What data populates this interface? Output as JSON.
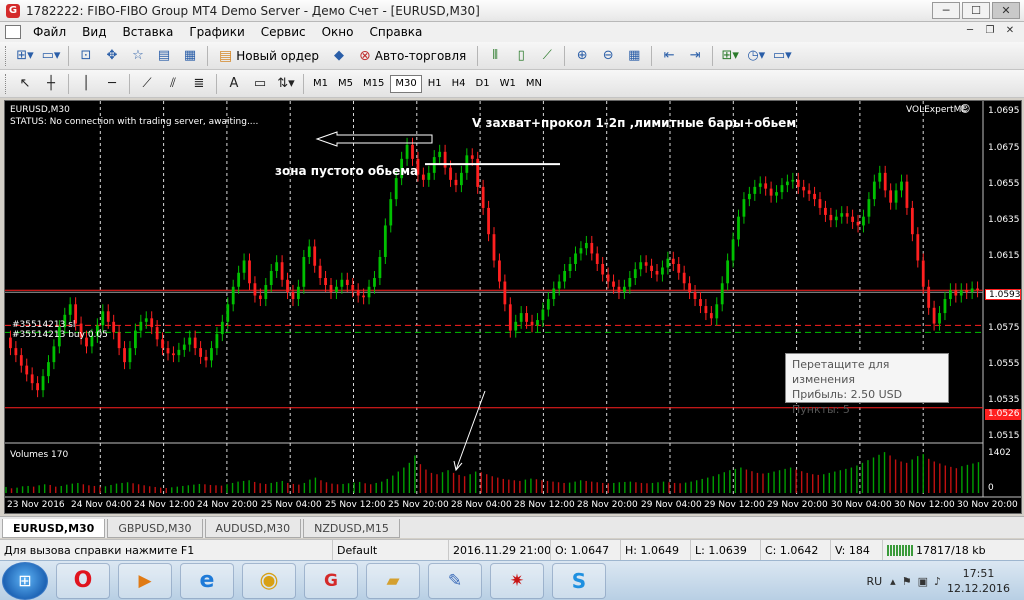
{
  "window": {
    "app_icon": "mt4-logo-icon",
    "title": "1782222: FIBO-FIBO Group MT4 Demo Server - Демо Счет - [EURUSD,M30]"
  },
  "menu": {
    "items": [
      "Файл",
      "Вид",
      "Вставка",
      "Графики",
      "Сервис",
      "Окно",
      "Справка"
    ]
  },
  "toolbar": {
    "new_order": "Новый ордер",
    "autotrade": "Авто-торговля",
    "timeframes": [
      "M1",
      "M5",
      "M15",
      "M30",
      "H1",
      "H4",
      "D1",
      "W1",
      "MN"
    ],
    "active_timeframe": "M30"
  },
  "chart": {
    "symbol": "EURUSD,M30",
    "status": "STATUS:    No connection with trading server, awaiting....",
    "expert": "VOLExpertME",
    "annotation_title": "V захват+прокол 1-2п ,лимитные бары+обьем",
    "annotation_zone": "зона пустого обьема",
    "sl_label": "#35514213 sl",
    "buy_label": "#35514213 buy 0.05",
    "volumes_label": "Volumes 170",
    "colors": {
      "bull": "#00c000",
      "bear": "#ff2020",
      "grid": "#ffffff",
      "price_line": "#ff2020"
    },
    "price_axis": [
      "1.0695",
      "1.0675",
      "1.0655",
      "1.0635",
      "1.0615",
      "1.0575",
      "1.0555",
      "1.0535",
      "1.0515"
    ],
    "current_price": "1.0593",
    "line_price": "1.0526",
    "volume_axis": [
      "1402",
      "0"
    ],
    "date_axis": [
      "23 Nov 2016",
      "24 Nov 04:00",
      "24 Nov 12:00",
      "24 Nov 20:00",
      "25 Nov 04:00",
      "25 Nov 12:00",
      "25 Nov 20:00",
      "28 Nov 04:00",
      "28 Nov 12:00",
      "28 Nov 20:00",
      "29 Nov 04:00",
      "29 Nov 12:00",
      "29 Nov 20:00",
      "30 Nov 04:00",
      "30 Nov 12:00",
      "30 Nov 20:00"
    ],
    "tooltip": {
      "line1": "Перетащите для изменения",
      "line2": "Прибыль: 2.50 USD",
      "line3": "Пункты: 5"
    }
  },
  "chart_data": {
    "type": "bar",
    "title": "EURUSD,M30",
    "ylim": [
      1.0507,
      1.0701
    ],
    "price_series": [
      1.0566,
      1.056,
      1.0556,
      1.055,
      1.0545,
      1.054,
      1.0536,
      1.0544,
      1.0552,
      1.0561,
      1.0572,
      1.0579,
      1.0585,
      1.0574,
      1.0566,
      1.0561,
      1.0567,
      1.0573,
      1.0581,
      1.0575,
      1.0569,
      1.056,
      1.0552,
      1.056,
      1.057,
      1.0575,
      1.0577,
      1.0572,
      1.0565,
      1.056,
      1.0557,
      1.0556,
      1.0559,
      1.0562,
      1.0566,
      1.056,
      1.0555,
      1.0553,
      1.056,
      1.0568,
      1.0575,
      1.0585,
      1.0595,
      1.0603,
      1.061,
      1.0597,
      1.059,
      1.0588,
      1.0596,
      1.0604,
      1.0609,
      1.0599,
      1.0592,
      1.0588,
      1.0595,
      1.0612,
      1.0618,
      1.0607,
      1.06,
      1.0596,
      1.0592,
      1.0595,
      1.0599,
      1.0596,
      1.0593,
      1.059,
      1.0589,
      1.0595,
      1.06,
      1.0612,
      1.063,
      1.0645,
      1.0657,
      1.0668,
      1.0676,
      1.0668,
      1.0659,
      1.0656,
      1.066,
      1.0669,
      1.0672,
      1.0663,
      1.0656,
      1.0653,
      1.066,
      1.067,
      1.0668,
      1.0652,
      1.064,
      1.0625,
      1.061,
      1.0598,
      1.0585,
      1.057,
      1.0575,
      1.058,
      1.0575,
      1.0573,
      1.0576,
      1.0582,
      1.0588,
      1.0594,
      1.0598,
      1.0604,
      1.0608,
      1.0614,
      1.0617,
      1.062,
      1.0614,
      1.0608,
      1.0602,
      1.0598,
      1.0595,
      1.0592,
      1.0595,
      1.06,
      1.0605,
      1.0609,
      1.0607,
      1.0604,
      1.0602,
      1.0606,
      1.0611,
      1.0608,
      1.0603,
      1.0597,
      1.0592,
      1.0588,
      1.0584,
      1.058,
      1.0577,
      1.0585,
      1.0597,
      1.061,
      1.0622,
      1.0635,
      1.0645,
      1.0648,
      1.0652,
      1.0654,
      1.0651,
      1.0647,
      1.0649,
      1.0653,
      1.0655,
      1.0656,
      1.0652,
      1.065,
      1.0648,
      1.0645,
      1.064,
      1.0636,
      1.0633,
      1.0635,
      1.0637,
      1.0635,
      1.0632,
      1.063,
      1.0635,
      1.0645,
      1.0655,
      1.066,
      1.065,
      1.0643,
      1.065,
      1.0655,
      1.064,
      1.0625,
      1.061,
      1.0595,
      1.0583,
      1.0574,
      1.058,
      1.0588,
      1.0593,
      1.059,
      1.0593,
      1.0592,
      1.0594,
      1.0593
    ],
    "volume_series": [
      180,
      140,
      160,
      200,
      210,
      190,
      230,
      260,
      240,
      190,
      210,
      250,
      280,
      300,
      260,
      230,
      210,
      190,
      200,
      240,
      280,
      300,
      320,
      290,
      260,
      230,
      200,
      180,
      160,
      150,
      170,
      190,
      210,
      230,
      250,
      270,
      260,
      240,
      230,
      220,
      260,
      300,
      340,
      360,
      380,
      330,
      290,
      270,
      300,
      330,
      360,
      300,
      270,
      250,
      300,
      400,
      460,
      380,
      320,
      280,
      260,
      270,
      290,
      310,
      330,
      290,
      260,
      300,
      340,
      420,
      520,
      640,
      760,
      900,
      1120,
      860,
      700,
      600,
      560,
      620,
      680,
      600,
      540,
      500,
      560,
      640,
      620,
      560,
      500,
      460,
      420,
      400,
      380,
      360,
      400,
      430,
      410,
      380,
      360,
      340,
      320,
      300,
      310,
      340,
      380,
      360,
      340,
      320,
      300,
      290,
      300,
      320,
      330,
      340,
      320,
      300,
      290,
      300,
      320,
      340,
      320,
      300,
      290,
      310,
      340,
      380,
      420,
      460,
      500,
      560,
      620,
      680,
      720,
      760,
      700,
      650,
      600,
      580,
      600,
      640,
      680,
      720,
      760,
      700,
      650,
      600,
      560,
      540,
      560,
      600,
      640,
      680,
      720,
      760,
      820,
      900,
      980,
      1060,
      1140,
      1220,
      1120,
      1000,
      940,
      900,
      1000,
      1100,
      1160,
      1020,
      940,
      880,
      820,
      780,
      740,
      800,
      840,
      880,
      920
    ],
    "lines": {
      "current_price": 1.0593,
      "sl": 1.0573,
      "buy": 1.0569,
      "red_line": 1.0526,
      "annotation_level": 1.0665
    }
  },
  "tabs": [
    "EURUSD,M30",
    "GBPUSD,M30",
    "AUDUSD,M30",
    "NZDUSD,M15"
  ],
  "status": {
    "help": "Для вызова справки нажмите F1",
    "profile": "Default",
    "datetime": "2016.11.29 21:00",
    "open": "O: 1.0647",
    "high": "H: 1.0649",
    "low": "L: 1.0639",
    "close": "C: 1.0642",
    "volume": "V: 184",
    "traffic": "17817/18 kb"
  },
  "taskbar": {
    "lang": "RU",
    "time": "17:51",
    "date": "12.12.2016",
    "apps": [
      "opera-icon",
      "media-player-icon",
      "ie-icon",
      "chrome-icon",
      "fibogroup-icon",
      "explorer-icon",
      "paint-icon",
      "pdf-icon",
      "skype-icon"
    ]
  }
}
